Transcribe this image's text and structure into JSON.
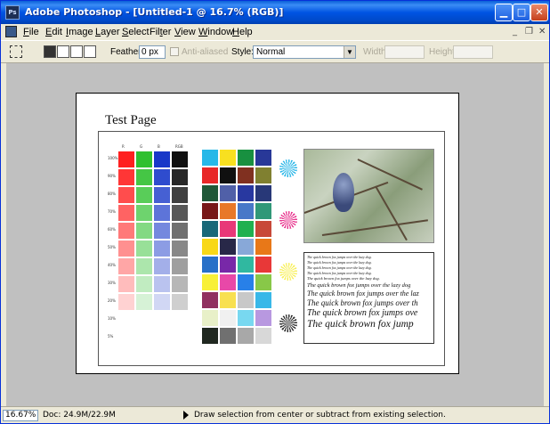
{
  "window": {
    "app_icon_text": "Ps",
    "title": "Adobe Photoshop - [Untitled-1 @ 16.7% (RGB)]"
  },
  "menu": [
    {
      "label": "File"
    },
    {
      "label": "Edit"
    },
    {
      "label": "Image"
    },
    {
      "label": "Layer"
    },
    {
      "label": "Select"
    },
    {
      "label": "Filter"
    },
    {
      "label": "View"
    },
    {
      "label": "Window"
    },
    {
      "label": "Help"
    }
  ],
  "options_bar": {
    "feather_label": "Feather:",
    "feather_value": "0 px",
    "anti_aliased_label": "Anti-aliased",
    "anti_aliased_checked": false,
    "style_label": "Style:",
    "style_value": "Normal",
    "width_label": "Width:",
    "width_value": "",
    "height_label": "Height:",
    "height_value": ""
  },
  "document": {
    "page_title": "Test Page",
    "column_headers": [
      "R",
      "G",
      "B",
      "RGB"
    ],
    "row_labels": [
      "100%",
      "90%",
      "80%",
      "70%",
      "60%",
      "50%",
      "40%",
      "30%",
      "20%",
      "10%",
      "5%"
    ],
    "ramp_base_colors": [
      "#ff2020",
      "#30c030",
      "#1838c8",
      "#101010"
    ],
    "swatch_colors": [
      [
        "#28b8e8",
        "#f8e020",
        "#189040",
        "#283898"
      ],
      [
        "#e82828",
        "#101010",
        "#803020",
        "#808030"
      ],
      [
        "#205838",
        "#5060a8",
        "#2838a0",
        "#283878"
      ],
      [
        "#781818",
        "#e87828",
        "#4878c8",
        "#309878"
      ],
      [
        "#186878",
        "#e83878",
        "#20b050",
        "#c84838"
      ],
      [
        "#f8d818",
        "#282848",
        "#88a8d8",
        "#e87818"
      ],
      [
        "#2870c8",
        "#7828a8",
        "#30b8a0",
        "#e83838"
      ],
      [
        "#f8f038",
        "#e848a8",
        "#2880e8",
        "#88c848"
      ],
      [
        "#903060",
        "#f8e050",
        "#c8c8c8",
        "#38b8e8"
      ],
      [
        "#e8f0c8",
        "#f0f0f0",
        "#78d8f0",
        "#b898e0"
      ],
      [
        "#202820",
        "#707070",
        "#a8a8a8",
        "#d8d8d8"
      ]
    ],
    "target_colors": [
      "#30b8e8",
      "#e83890",
      "#f8f060",
      "#303030"
    ],
    "pangram_lines": [
      "The quick brown fox jumps over the lazy dog.",
      "The quick brown fox jumps over the lazy dog.",
      "The quick brown fox jumps over the lazy dog.",
      "The quick brown fox jumps over the lazy dog.",
      "The quick brown fox jumps over the lazy dog.",
      "The quick brown fox jumps over the lazy dog",
      "The quick brown fox jumps over the laz",
      "The quick brown fox jumps over th",
      "The quick brown fox jumps ove",
      "The quick brown fox jump"
    ]
  },
  "status_bar": {
    "zoom": "16.67%",
    "doc_info": "Doc: 24.9M/22.9M",
    "hint": "Draw selection from center or subtract from existing selection."
  }
}
